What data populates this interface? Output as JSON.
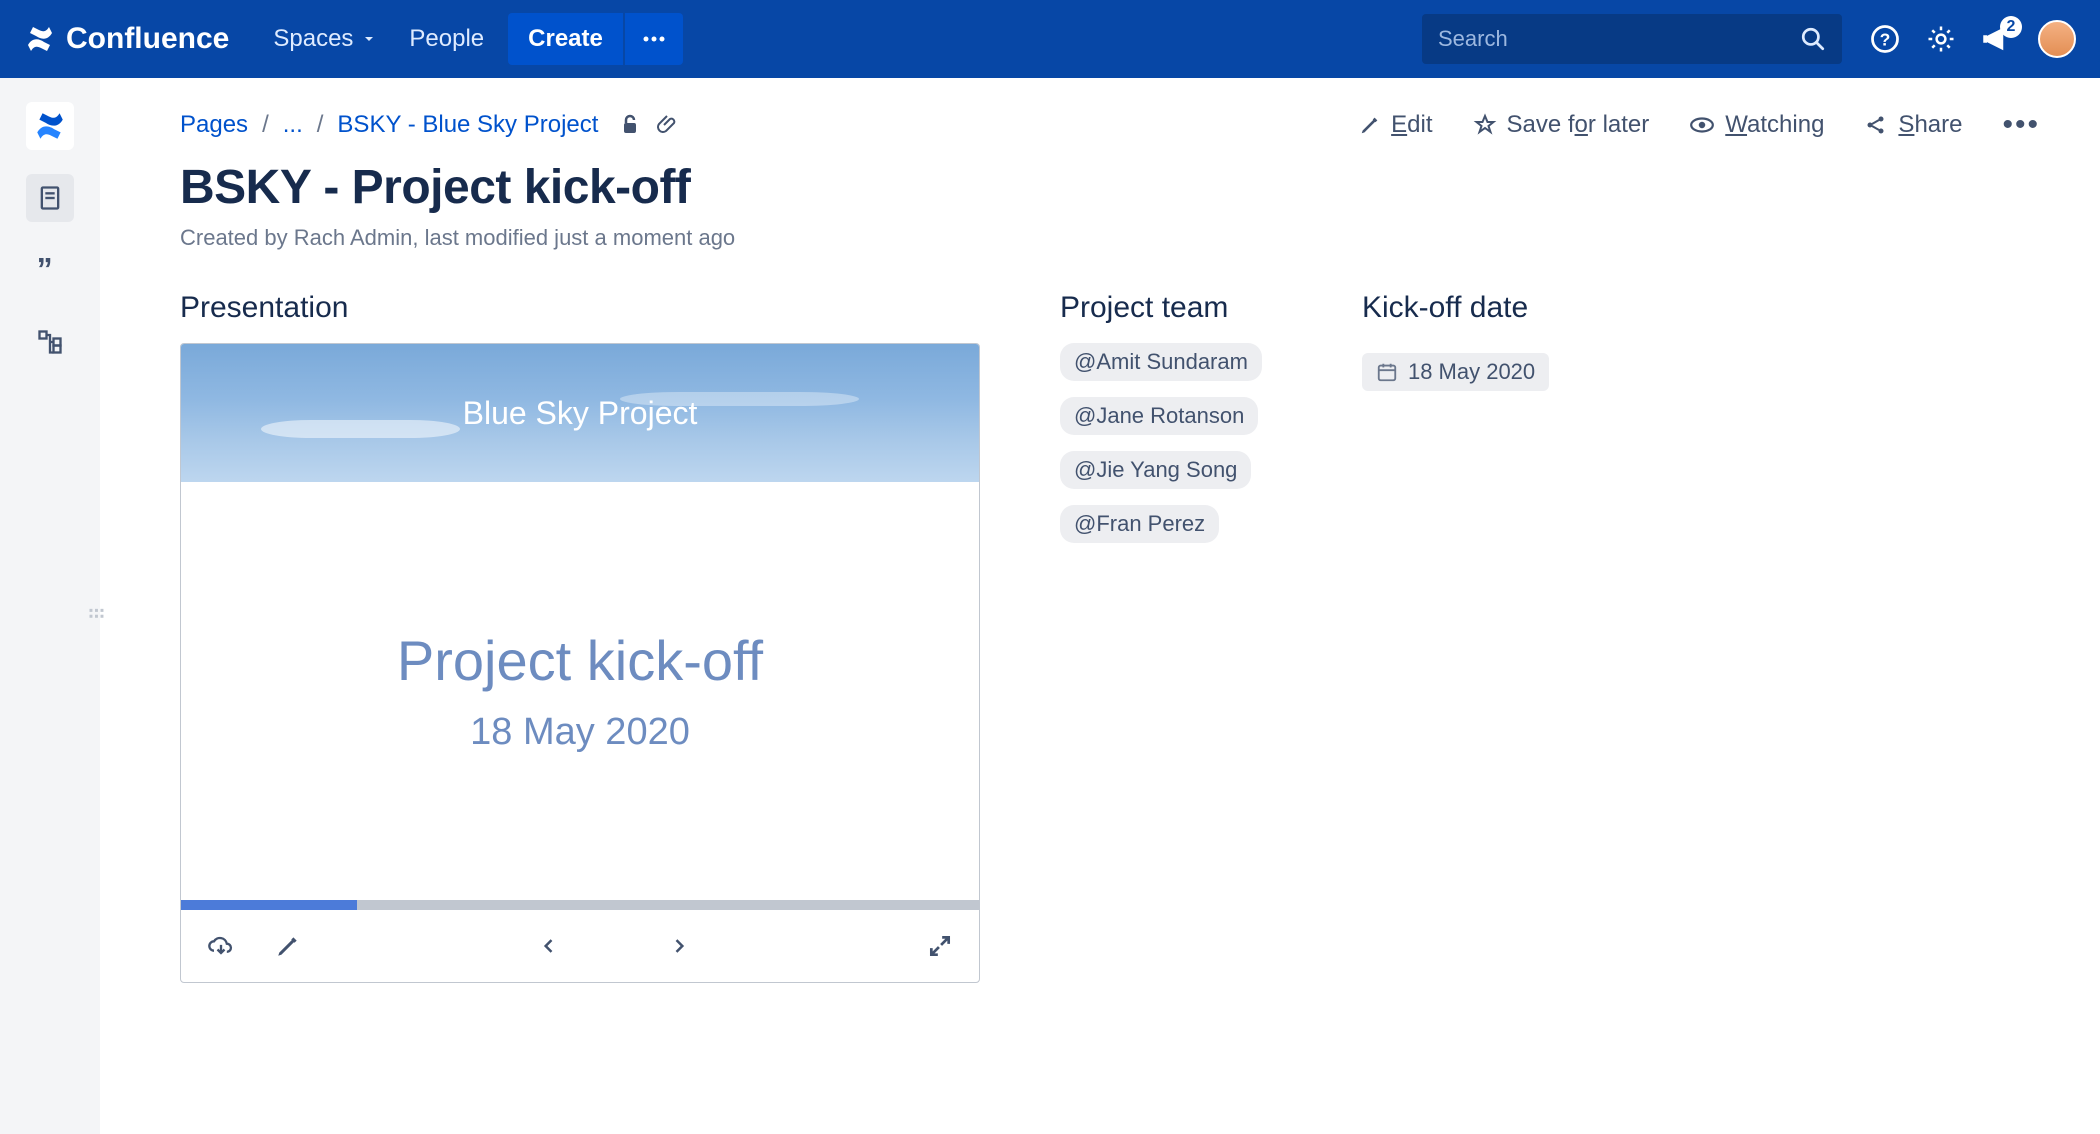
{
  "nav": {
    "brand": "Confluence",
    "spaces": "Spaces",
    "people": "People",
    "create": "Create",
    "search_placeholder": "Search",
    "notification_count": "2"
  },
  "breadcrumb": {
    "pages": "Pages",
    "ellipsis": "...",
    "parent": "BSKY - Blue Sky Project"
  },
  "actions": {
    "edit": "dit",
    "edit_ul": "E",
    "save": "Save f",
    "save2": "r later",
    "save_ul": "o",
    "watch_ul": "W",
    "watch": "atching",
    "share_ul": "S",
    "share": "hare"
  },
  "page": {
    "title": "BSKY - Project kick-off",
    "byline": "Created by Rach Admin, last modified just a moment ago"
  },
  "sections": {
    "presentation": "Presentation",
    "team": "Project team",
    "kickoff_date": "Kick-off date"
  },
  "presentation": {
    "banner": "Blue Sky Project",
    "heading": "Project kick-off",
    "date": "18 May 2020"
  },
  "team": [
    "@Amit Sundaram",
    "@Jane Rotanson",
    "@Jie Yang Song",
    "@Fran Perez"
  ],
  "kickoff_date": "18 May 2020"
}
